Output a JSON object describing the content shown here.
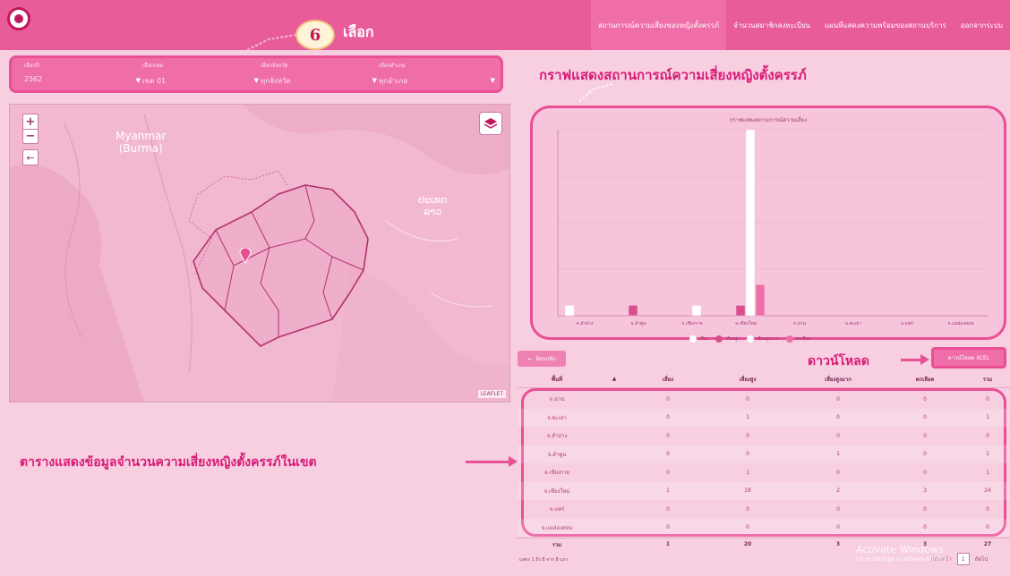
{
  "header": {
    "nav": [
      "สถานการณ์ความเสี่ยงของหญิงตั้งครรภ์",
      "จำนวนสมาชิกลงทะเบียน",
      "แผนที่แสดงความพร้อมของสถานบริการ",
      "ออกจากระบบ"
    ]
  },
  "annotations": {
    "step_number": "6",
    "step_label": "เลือก",
    "graph_caption": "กราฟแสดงสถานการณ์ความเสี่ยงหญิงตั้งครรภ์",
    "table_caption": "ตารางแสดงข้อมูลจำนวนความเสี่ยงหญิงตั้งครรภ์ในเขต",
    "download_caption": "ดาวน์โหลด"
  },
  "filters": [
    {
      "label": "เลือกปี",
      "value": "2562"
    },
    {
      "label": "เลือกเขต",
      "value": "เขต 01"
    },
    {
      "label": "เลือกจังหวัด",
      "value": "ทุกจังหวัด"
    },
    {
      "label": "เลือกอำเภอ",
      "value": "ทุกอำเภอ"
    }
  ],
  "map": {
    "country_label": "Myanmar\n(Burma)",
    "laos_label": "ປະເທດ\nລາວ",
    "credit": "LEAFLET"
  },
  "chart_data": {
    "type": "bar",
    "title": "กราฟแสดงสถานการณ์ความเสี่ยง",
    "ylabel": "",
    "ylim": [
      0,
      18
    ],
    "categories": [
      "จ.ลำปาง",
      "จ.ลำพูน",
      "จ.เชียงราย",
      "จ.เชียงใหม่",
      "จ.น่าน",
      "จ.พะเยา",
      "จ.แพร่",
      "จ.แม่ฮ่องสอน"
    ],
    "series": [
      {
        "name": "เสี่ยง",
        "color": "#ffffff",
        "values": [
          1,
          0,
          0,
          0,
          0,
          0,
          0,
          0
        ]
      },
      {
        "name": "เสี่ยงสูง",
        "color": "#d94e8f",
        "values": [
          0,
          1,
          0,
          1,
          0,
          0,
          0,
          0
        ]
      },
      {
        "name": "เสี่ยงสูงมาก",
        "color": "#ffffff",
        "values": [
          0,
          0,
          1,
          18,
          0,
          0,
          0,
          0
        ]
      },
      {
        "name": "ตกเลือด",
        "color": "#f06ea8",
        "values": [
          0,
          0,
          0,
          3,
          0,
          0,
          0,
          0
        ]
      }
    ]
  },
  "table": {
    "back_label": "ย้อนกลับ",
    "excel_label": "ดาวน์โหลด XCEL",
    "columns": [
      "พื้นที่",
      "",
      "เสี่ยง",
      "เสี่ยงสูง",
      "เสี่ยงสูงมาก",
      "ตกเลือด",
      "รวม"
    ],
    "rows": [
      [
        "จ.น่าน",
        "",
        "0",
        "0",
        "0",
        "0",
        "0"
      ],
      [
        "จ.พะเยา",
        "",
        "0",
        "1",
        "0",
        "0",
        "1"
      ],
      [
        "จ.ลำปาง",
        "",
        "0",
        "0",
        "0",
        "0",
        "0"
      ],
      [
        "จ.ลำพูน",
        "",
        "0",
        "0",
        "1",
        "0",
        "1"
      ],
      [
        "จ.เชียงราย",
        "",
        "0",
        "1",
        "0",
        "0",
        "1"
      ],
      [
        "จ.เชียงใหม่",
        "",
        "1",
        "18",
        "2",
        "3",
        "24"
      ],
      [
        "จ.แพร่",
        "",
        "0",
        "0",
        "0",
        "0",
        "0"
      ],
      [
        "จ.แม่ฮ่องสอน",
        "",
        "0",
        "0",
        "0",
        "0",
        "0"
      ]
    ],
    "total": [
      "รวม",
      "",
      "1",
      "20",
      "3",
      "3",
      "27"
    ],
    "info": "แสดง 1 ถึง 8 จาก 8 แถว",
    "pager_prev": "ก่อนหน้า",
    "pager_page": "1",
    "pager_next": "ถัดไป"
  },
  "watermark": {
    "title": "Activate Windows",
    "subtitle": "Go to Settings to activate Windows."
  }
}
